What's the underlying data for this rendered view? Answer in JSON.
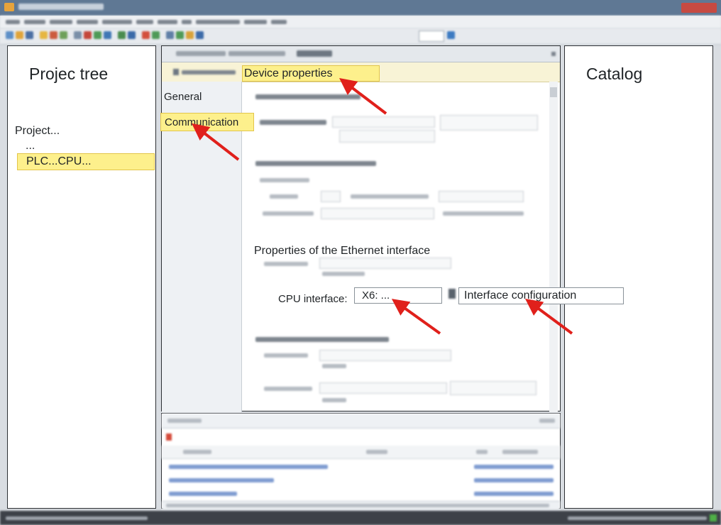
{
  "annotations": {
    "project_tree_title": "Projec tree",
    "catalog_title": "Catalog",
    "project_item": "Project...",
    "ellipsis_item": "...",
    "plc_cpu_item": "PLC...CPU...",
    "device_properties": "Device properties",
    "nav_general": "General",
    "nav_communication": "Communication",
    "ethernet_heading": "Properties of the Ethernet interface",
    "cpu_interface_label": "CPU interface:",
    "cpu_interface_value": "X6: ...",
    "interface_configuration": "Interface configuration"
  },
  "colors": {
    "highlight": "#fdf08c",
    "arrow": "#e0201b",
    "panel_border": "#2c2f33"
  },
  "icons": [
    "app-icon",
    "window-close-icon",
    "toolbar-icons",
    "scroll-arrow-icon",
    "warning-icon",
    "connect-icon"
  ]
}
